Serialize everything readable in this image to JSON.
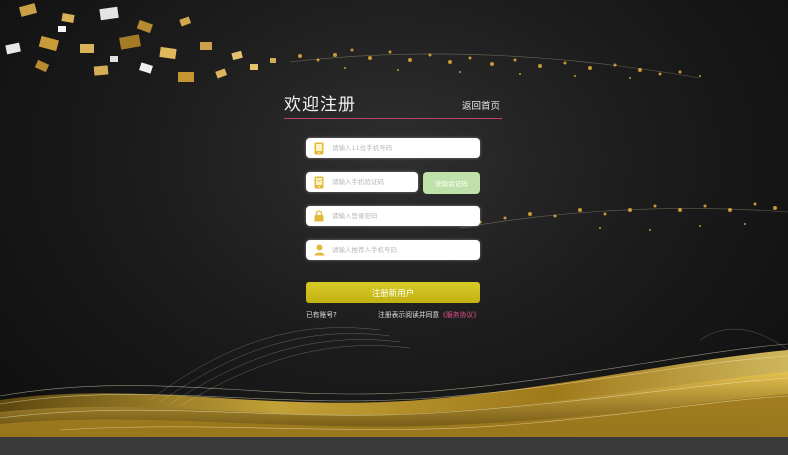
{
  "header": {
    "title": "欢迎注册",
    "back_link": "返回首页"
  },
  "form": {
    "phone_placeholder": "请输入11位手机号码",
    "code_placeholder": "请输入手机验证码",
    "get_code_label": "获取验证码",
    "password_placeholder": "请输入登录密码",
    "referrer_placeholder": "请输入推荐人手机号码",
    "submit_label": "注册新用户"
  },
  "footer": {
    "have_account": "已有账号?",
    "agree_text": "注册表示阅读并同意",
    "agreement_link": "《服务协议》"
  },
  "colors": {
    "accent_yellow": "#cfc01b",
    "code_button_green": "#bfe0a8",
    "divider_pink": "#c1436b",
    "agreement_pink": "#e0508a",
    "gold": "#c9a227"
  },
  "icons": {
    "phone": "phone-icon",
    "code": "message-phone-icon",
    "password": "lock-icon",
    "referrer": "user-icon"
  }
}
